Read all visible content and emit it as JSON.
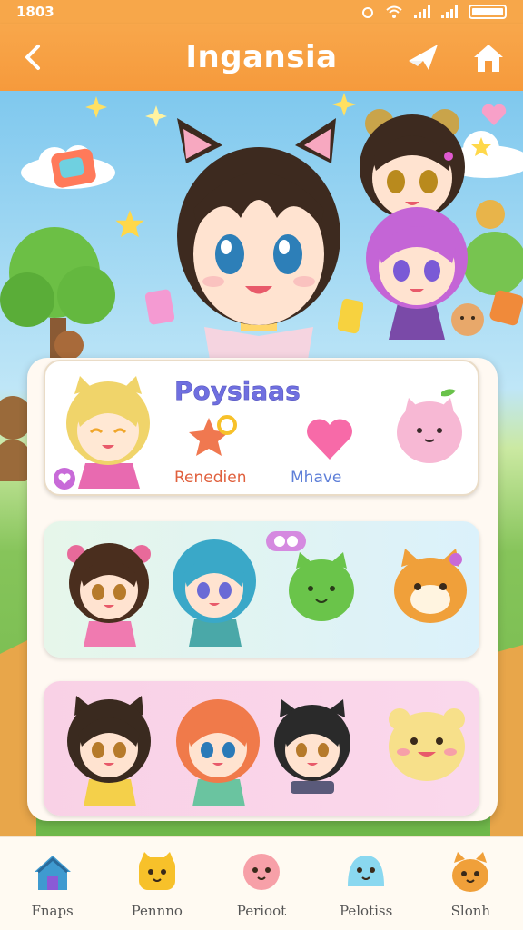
{
  "status_bar": {
    "time": "1803"
  },
  "header": {
    "title": "Ingansia"
  },
  "panel": {
    "row1": {
      "title": "Poysiaas",
      "action1": "Renedien",
      "action2": "Mhave"
    }
  },
  "bottom_nav": [
    {
      "label": "Fnaps",
      "icon": "house-icon"
    },
    {
      "label": "Pennno",
      "icon": "yellow-pet-icon"
    },
    {
      "label": "Perioot",
      "icon": "pink-pet-icon"
    },
    {
      "label": "Pelotiss",
      "icon": "blue-pet-icon"
    },
    {
      "label": "Slonh",
      "icon": "orange-pet-icon"
    }
  ],
  "colors": {
    "header": "#f69a3c",
    "panel_bg": "#fff9f2",
    "title_purple": "#6f6fe0"
  }
}
